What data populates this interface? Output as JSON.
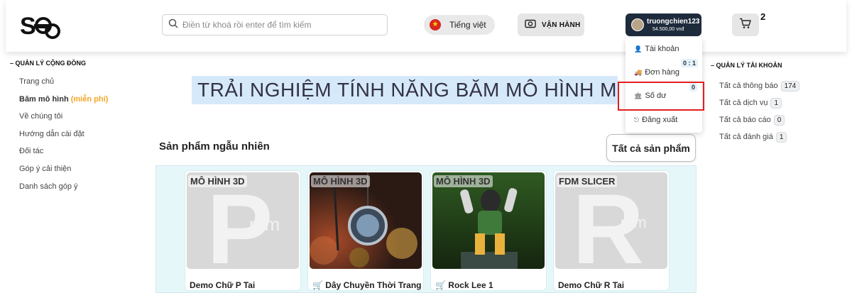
{
  "header": {
    "logo_text": "SDP",
    "search_placeholder": "Điền từ khoá rồi enter để tìm kiếm",
    "language_label": "Tiếng việt",
    "operations_label": "VẬN HÀNH",
    "user": {
      "name": "truongchien123",
      "balance": "54.500,00 vnđ"
    },
    "cart_count": "2"
  },
  "left_nav": {
    "heading": "– QUẢN LÝ CỘNG ĐỒNG",
    "items": [
      {
        "label": "Trang chủ"
      },
      {
        "label": "Băm mô hình",
        "extra": "(miễn phí)"
      },
      {
        "label": "Về chúng tôi"
      },
      {
        "label": "Hướng dẫn cài đặt"
      },
      {
        "label": "Đối tác"
      },
      {
        "label": "Góp ý cải thiện"
      },
      {
        "label": "Danh sách góp ý"
      }
    ]
  },
  "right_nav": {
    "heading": "– QUẢN LÝ TÀI KHOẢN",
    "items": [
      {
        "label": "Tất cả thông báo",
        "count": "174"
      },
      {
        "label": "Tất cả dịch vụ",
        "count": "1"
      },
      {
        "label": "Tất cả báo cáo",
        "count": "0"
      },
      {
        "label": "Tất cả đánh giá",
        "count": "1"
      }
    ]
  },
  "user_menu": {
    "items": [
      {
        "label": "Tài khoản",
        "icon": "user-icon"
      },
      {
        "label": "Đơn hàng",
        "icon": "truck-icon",
        "badge": "0 : 1"
      },
      {
        "label": "Số dư",
        "icon": "bank-icon",
        "badge": "0"
      },
      {
        "label": "Đăng xuất",
        "icon": "logout-icon"
      }
    ]
  },
  "banner": {
    "text": "TRẢI NGHIỆM TÍNH NĂNG BĂM MÔ HÌNH MIỄN PHÍ"
  },
  "products": {
    "title": "Sản phẩm ngẫu nhiên",
    "all_button": "Tất cả sản phẩm",
    "items": [
      {
        "tag": "MÔ HÌNH 3D",
        "name": "Demo Chữ P Tai",
        "thumb_letter": "P"
      },
      {
        "tag": "MÔ HÌNH 3D",
        "name": "Dây Chuyền Thời Trang"
      },
      {
        "tag": "MÔ HÌNH 3D",
        "name": "Rock Lee 1"
      },
      {
        "tag": "FDM SLICER",
        "name": "Demo Chữ R Tai",
        "thumb_letter": "R"
      }
    ],
    "watermark_text": "mm"
  }
}
